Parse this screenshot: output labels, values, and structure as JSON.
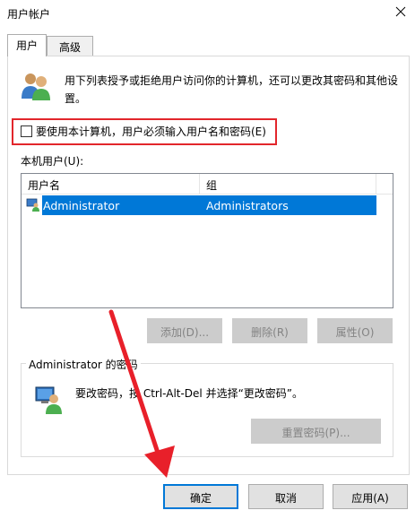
{
  "window": {
    "title": "用户帐户"
  },
  "tabs": [
    {
      "label": "用户",
      "selected": true
    },
    {
      "label": "高级",
      "selected": false
    }
  ],
  "description": "用下列表授予或拒绝用户访问你的计算机，还可以更改其密码和其他设置。",
  "require_login_checkbox": {
    "label": "要使用本计算机，用户必须输入用户名和密码(E)",
    "checked": false
  },
  "local_users": {
    "label": "本机用户(U):",
    "columns": [
      "用户名",
      "组"
    ],
    "rows": [
      {
        "username": "Administrator",
        "group": "Administrators",
        "selected": true
      }
    ]
  },
  "user_buttons": {
    "add": "添加(D)...",
    "delete": "删除(R)",
    "properties": "属性(O)"
  },
  "password_group": {
    "title": "Administrator 的密码",
    "text": "要改密码，按 Ctrl-Alt-Del 并选择“更改密码”。",
    "reset_button": "重置密码(P)..."
  },
  "dialog_buttons": {
    "ok": "确定",
    "cancel": "取消",
    "apply": "应用(A)"
  },
  "colors": {
    "selection": "#0078d7",
    "highlight": "#e2262c",
    "arrow": "#e8202a"
  }
}
